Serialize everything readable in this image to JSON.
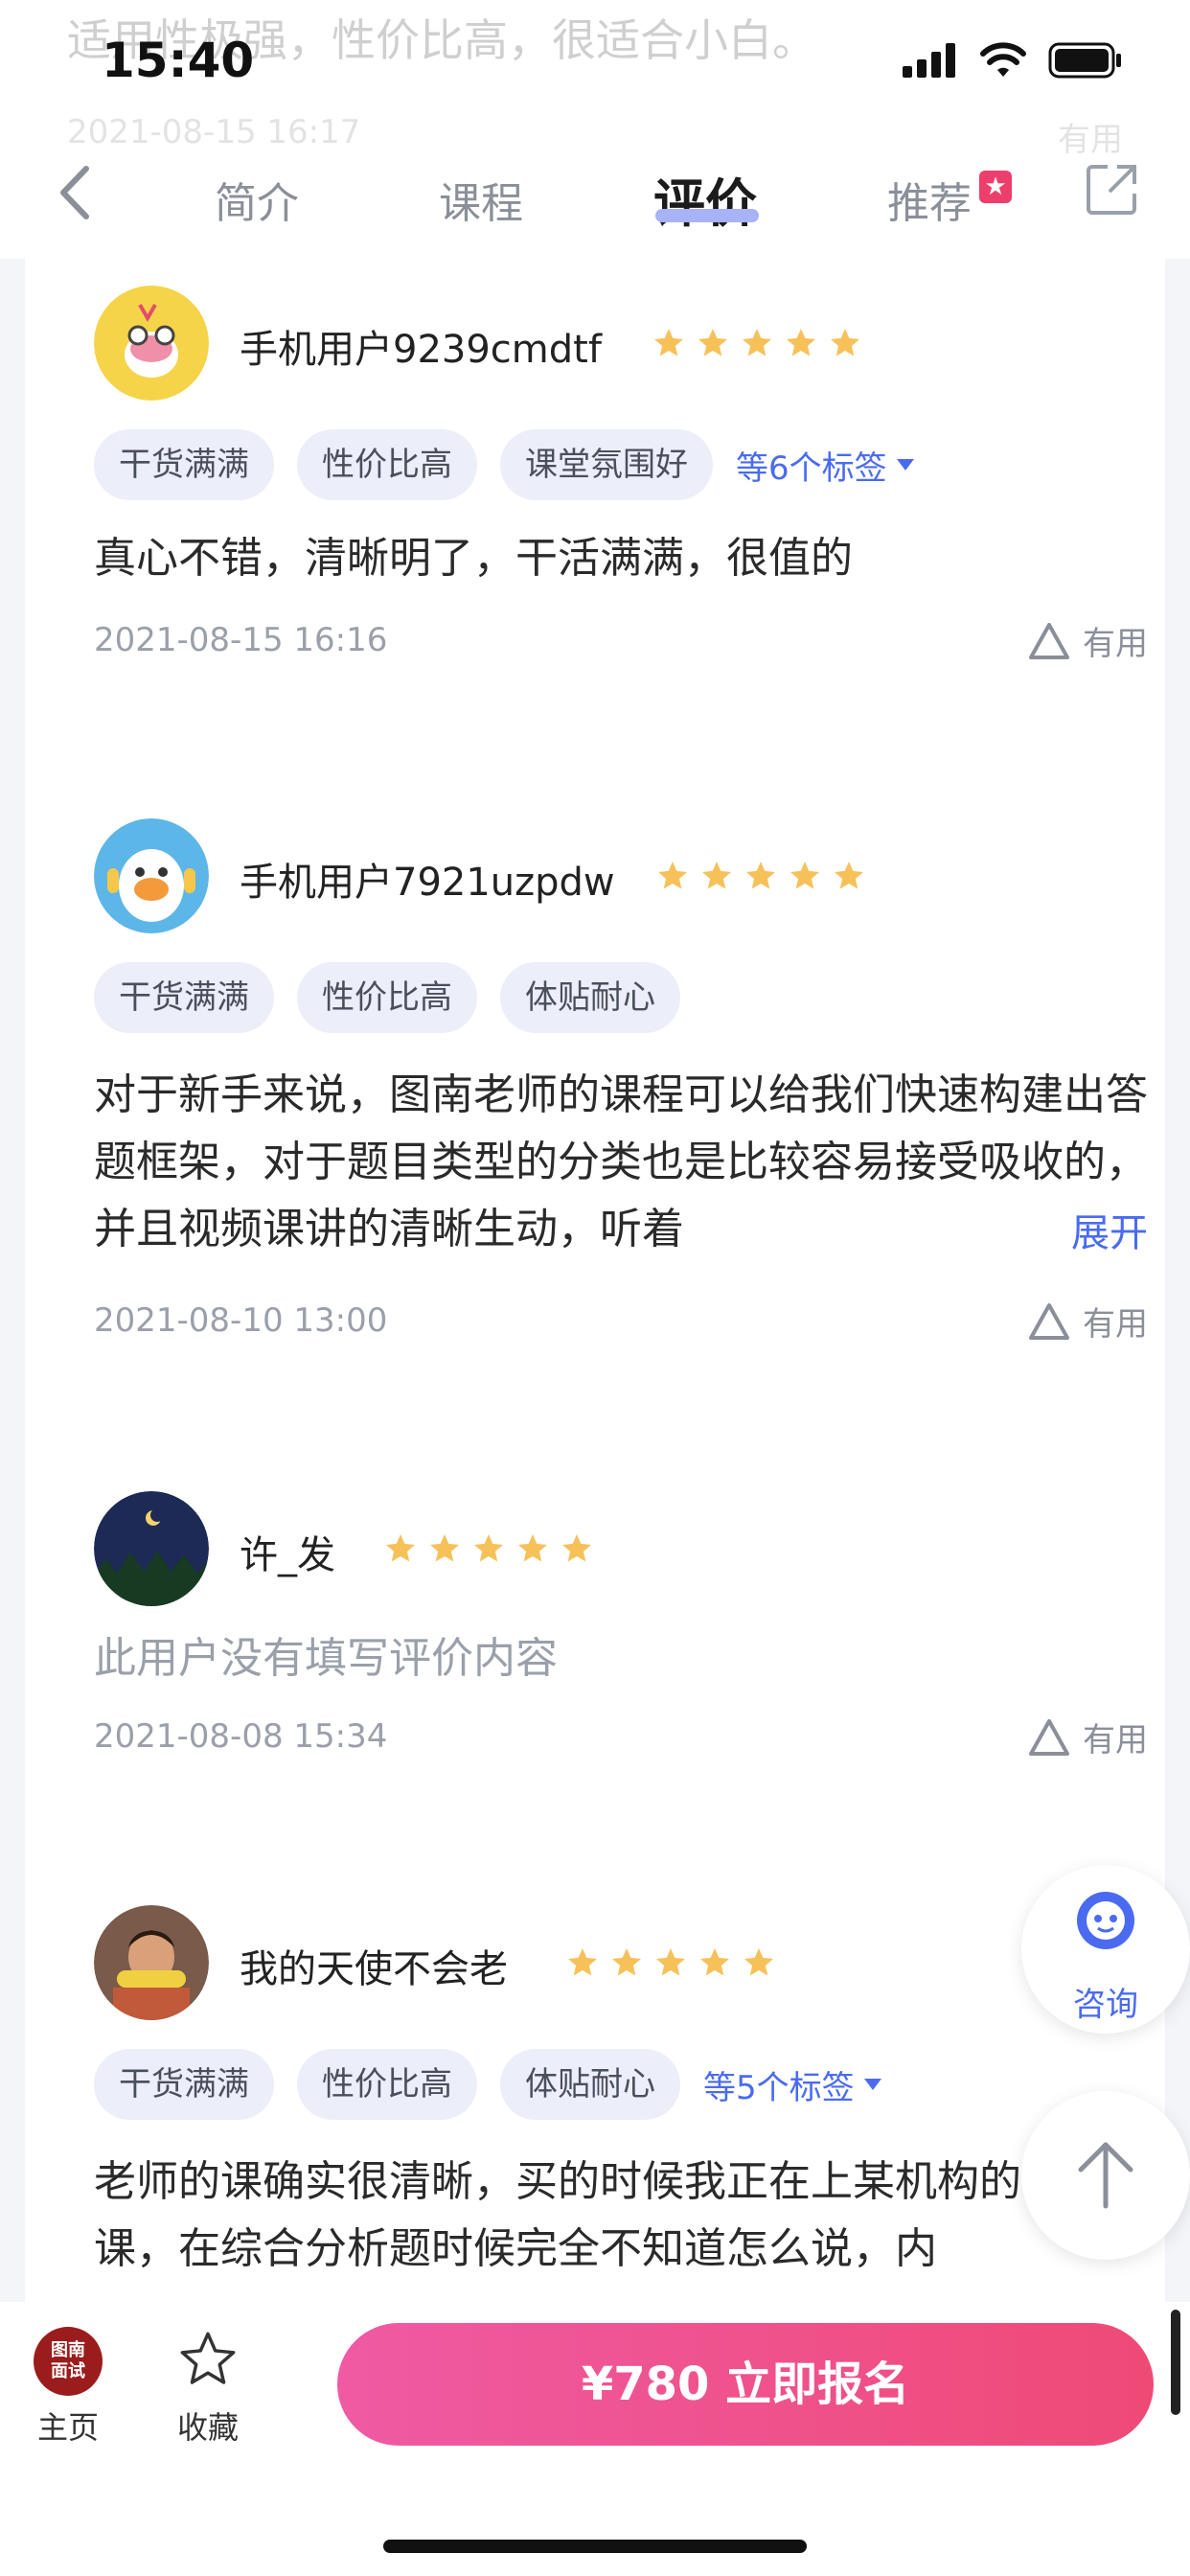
{
  "status_bar": {
    "time": "15:40"
  },
  "ghost_prev": {
    "text": "适用性极强，性价比高，很适合小白。",
    "date": "2021-08-15 16:17",
    "useful": "有用"
  },
  "nav": {
    "tabs": [
      {
        "label": "简介"
      },
      {
        "label": "课程"
      },
      {
        "label": "评价"
      },
      {
        "label": "推荐"
      }
    ],
    "active_tab": "评价",
    "badge_glyph": "★"
  },
  "reviews": [
    {
      "user": "手机用户9239cmdtf",
      "rating": 5,
      "tags": [
        "干货满满",
        "性价比高",
        "课堂氛围好"
      ],
      "more_tags": "等6个标签",
      "content": "真心不错，清晰明了，干活满满，很值的",
      "date": "2021-08-15 16:16",
      "useful": "有用"
    },
    {
      "user": "手机用户7921uzpdw",
      "rating": 5,
      "tags": [
        "干货满满",
        "性价比高",
        "体贴耐心"
      ],
      "content": "对于新手来说，图南老师的课程可以给我们快速构建出答题框架，对于题目类型的分类也是比较容易接受吸收的，并且视频课讲的清晰生动，听着",
      "expand": "展开",
      "date": "2021-08-10 13:00",
      "useful": "有用"
    },
    {
      "user": "许_发",
      "rating": 5,
      "content": "此用户没有填写评价内容",
      "date": "2021-08-08 15:34",
      "useful": "有用"
    },
    {
      "user": "我的天使不会老",
      "rating": 5,
      "tags": [
        "干货满满",
        "性价比高",
        "体贴耐心"
      ],
      "more_tags": "等5个标签",
      "content": "老师的课确实很清晰，买的时候我正在上某机构的线下课，在综合分析题时候完全不知道怎么说，内"
    }
  ],
  "float": {
    "consult": "咨询"
  },
  "bottom_bar": {
    "home_logo_line1": "图南",
    "home_logo_line2": "面试",
    "home_label": "主页",
    "favorite_label": "收藏",
    "cta": "¥780  立即报名"
  },
  "colors": {
    "accent": "#4a6bf0",
    "star": "#f7c15a",
    "cta_start": "#ef5aa3",
    "cta_end": "#ef4a76",
    "badge": "#ee3e6b"
  }
}
